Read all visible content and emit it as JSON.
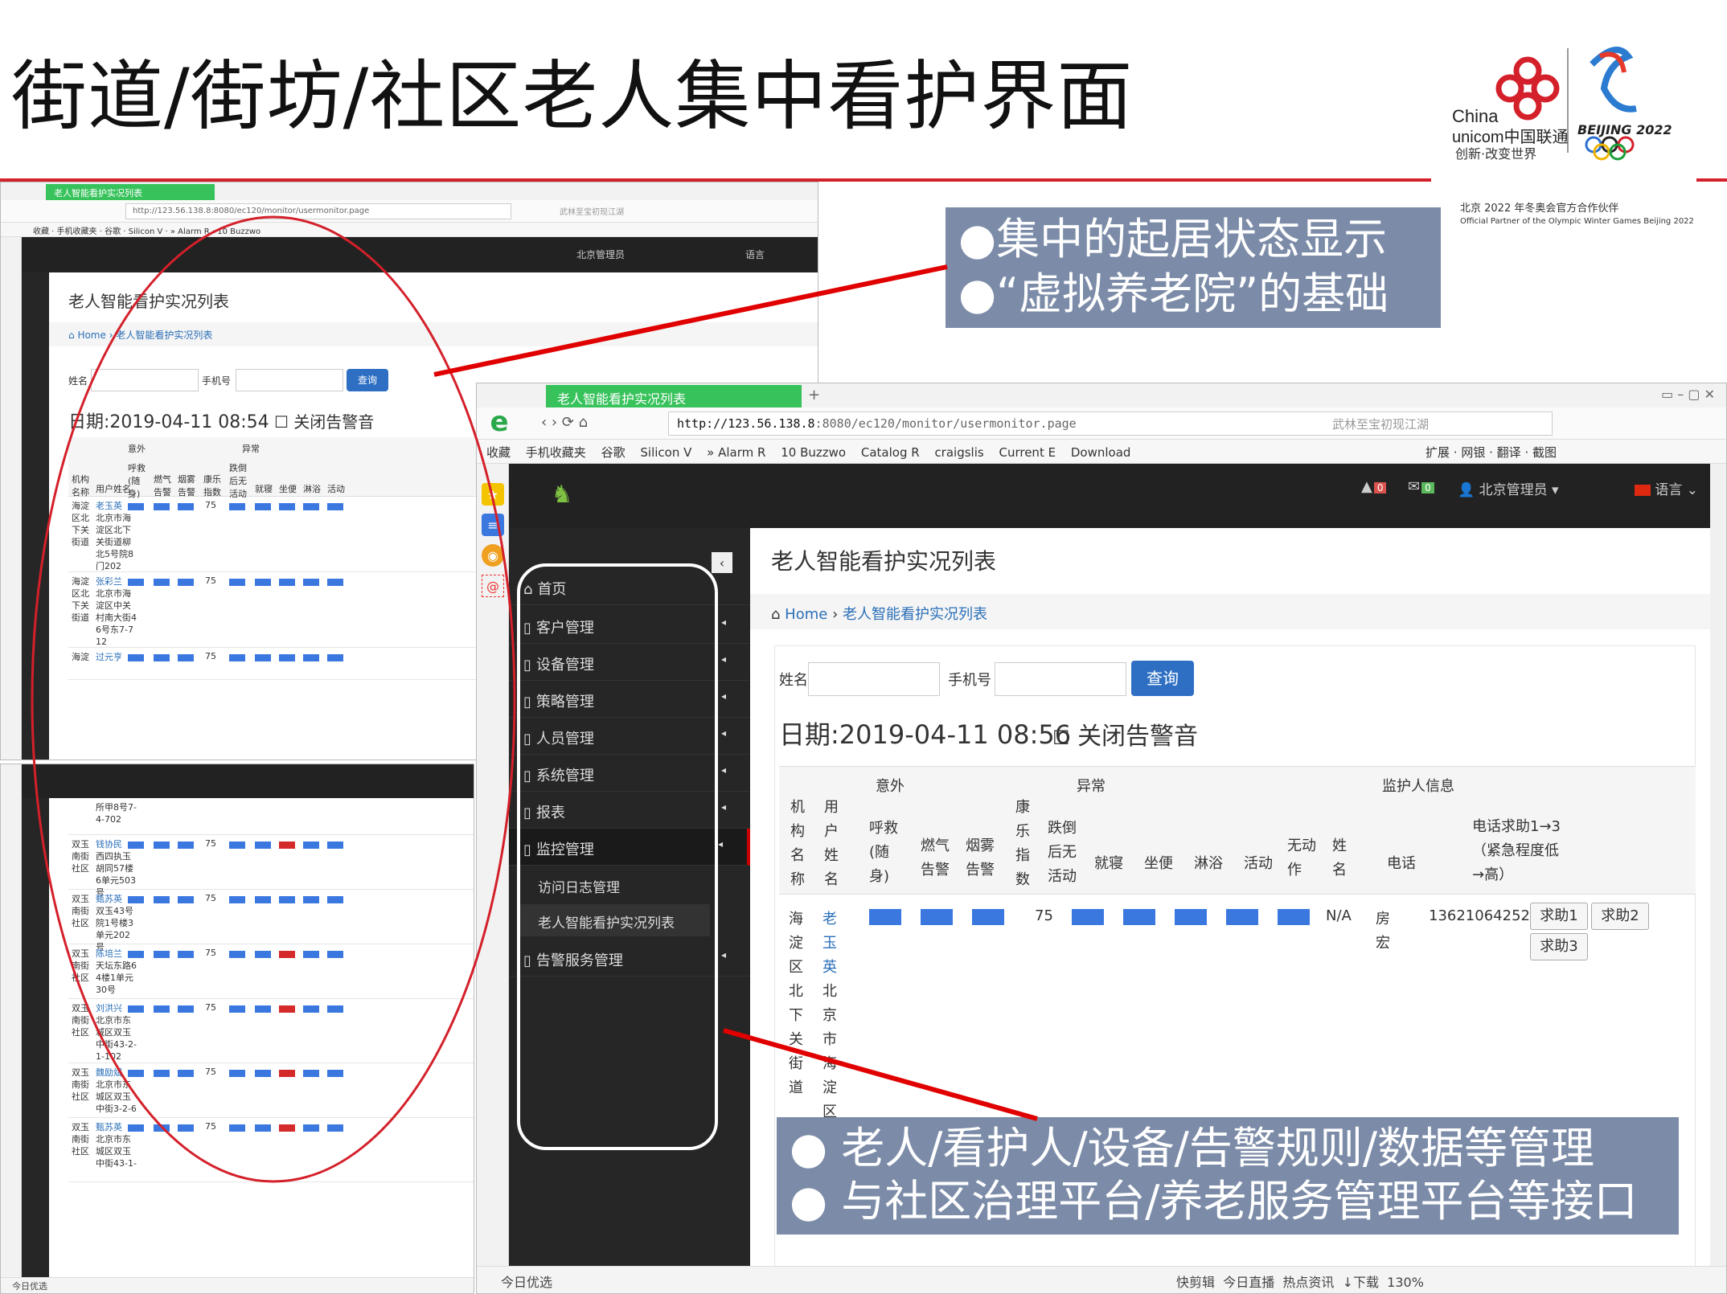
{
  "slide_title": "街道/街坊/社区老人集中看护界面",
  "logo": {
    "brand_en1": "China",
    "brand_en2": "unicom中国联通",
    "brand_slogan": "创新·改变世界",
    "beijing": "BEIJING 2022",
    "partner_cn": "北京 2022 年冬奥会官方合作伙伴",
    "partner_en": "Official Partner of the Olympic Winter Games Beijing 2022"
  },
  "callout_top": {
    "line1": "●集中的起居状态显示",
    "line2": "●“虚拟养老院”的基础"
  },
  "callout_bottom": {
    "line1": "●  老人/看护人/设备/告警规则/数据等管理",
    "line2": "●  与社区治理平台/养老服务管理平台等接口"
  },
  "browser": {
    "tab_title": "老人智能看护实况列表",
    "url_prefix": "http://123.56.138.8",
    "url_rest": ":8080/ec120/monitor/usermonitor.page",
    "search_hint": "武林至宝初现江湖",
    "bookmarks": [
      "收藏",
      "手机收藏夹",
      "谷歌",
      "Silicon V",
      "» Alarm R",
      "10 Buzzwo",
      "Catalog R",
      "craigslis",
      "Current E",
      "Download",
      "»"
    ],
    "bookmarks_right": [
      "扩展",
      "网银",
      "翻译",
      "截图",
      "»"
    ],
    "status_left": "今日优选",
    "status_right": [
      "快剪辑",
      "今日直播",
      "热点资讯",
      "↓下载",
      "130%"
    ]
  },
  "topnav": {
    "alert_count": "0",
    "mail_count": "0",
    "user": "北京管理员",
    "lang": "语言"
  },
  "sidebar": {
    "items": [
      "首页",
      "客户管理",
      "设备管理",
      "策略管理",
      "人员管理",
      "系统管理",
      "报表",
      "监控管理",
      "告警服务管理"
    ],
    "sub_items": [
      "访问日志管理",
      "老人智能看护实况列表"
    ]
  },
  "page": {
    "title": "老人智能看护实况列表",
    "breadcrumb_home": "Home",
    "breadcrumb_sep": "›",
    "breadcrumb_current": "老人智能看护实况列表",
    "name_label": "姓名",
    "phone_label": "手机号",
    "query_button": "查询",
    "date_back": "日期:2019-04-11 08:54",
    "date_front": "日期:2019-04-11 08:56",
    "mute_label": "关闭告警音"
  },
  "table": {
    "group_accident": "意外",
    "group_abnormal": "异常",
    "group_guardian": "监护人信息",
    "col_org": "机构名称",
    "col_user": "用户姓名",
    "col_sos": "呼救(随身)",
    "col_gas": "燃气告警",
    "col_smoke": "烟雾告警",
    "col_index": "康乐指数",
    "col_fall": "跌倒后无活动",
    "col_sleep": "就寝",
    "col_toilet": "坐便",
    "col_bath": "淋浴",
    "col_activity": "活动",
    "col_noact": "无动作",
    "col_gname": "姓名",
    "col_phone": "电话",
    "col_help": "电话求助1→3（紧急程度低→高）",
    "front_row": {
      "org": "海淀区北下关街道",
      "user": "老玉英",
      "addr": "北京市海淀区柳",
      "index": "75",
      "noact": "N/A",
      "gname": "房宏",
      "phone": "13621064252",
      "help": [
        "求助1",
        "求助2",
        "求助3"
      ]
    },
    "back_rows": [
      {
        "org": "海淀区北下关街道",
        "user": "老玉英",
        "addr": "北京市海淀区北下关街道柳北5号院8门202",
        "index": "75",
        "reds": []
      },
      {
        "org": "海淀区北下关街道",
        "user": "张彩兰",
        "addr": "北京市海淀区中关村南大街46号东7-712",
        "index": "75",
        "reds": []
      },
      {
        "org": "海淀",
        "user": "过元亨",
        "addr": "",
        "index": "75",
        "reds": []
      }
    ],
    "lower_rows": [
      {
        "org": "",
        "user": "",
        "addr": "所甲8号7-4-702",
        "index": "",
        "reds": []
      },
      {
        "org": "双玉南街社区",
        "user": "钱协民",
        "addr": "西四执玉胡同57楼6单元503号",
        "index": "75",
        "reds": [
          5
        ]
      },
      {
        "org": "双玉南街社区",
        "user": "甄苏英",
        "addr": "双玉43号院1号楼3单元202号",
        "index": "75",
        "reds": []
      },
      {
        "org": "双玉南街社区",
        "user": "陈培兰",
        "addr": "天坛东路64楼1单元30号",
        "index": "75",
        "reds": [
          5
        ]
      },
      {
        "org": "双玉南街社区",
        "user": "刘洪兴",
        "addr": "北京市东城区双玉中街43-2-1-102",
        "index": "75",
        "reds": [
          5
        ]
      },
      {
        "org": "双玉南街社区",
        "user": "魏励斌",
        "addr": "北京市东城区双玉中街3-2-6",
        "index": "75",
        "reds": [
          5
        ]
      },
      {
        "org": "双玉南街社区",
        "user": "甄苏英",
        "addr": "北京市东城区双玉中街43-1-",
        "index": "75",
        "reds": [
          5
        ]
      }
    ]
  },
  "colors": {
    "bar_blue": "#3a78e0",
    "bar_red": "#d42a2a",
    "accent_red": "#d4202a",
    "tab_green": "#37c25b",
    "callout_bg": "#7c8ca8"
  }
}
